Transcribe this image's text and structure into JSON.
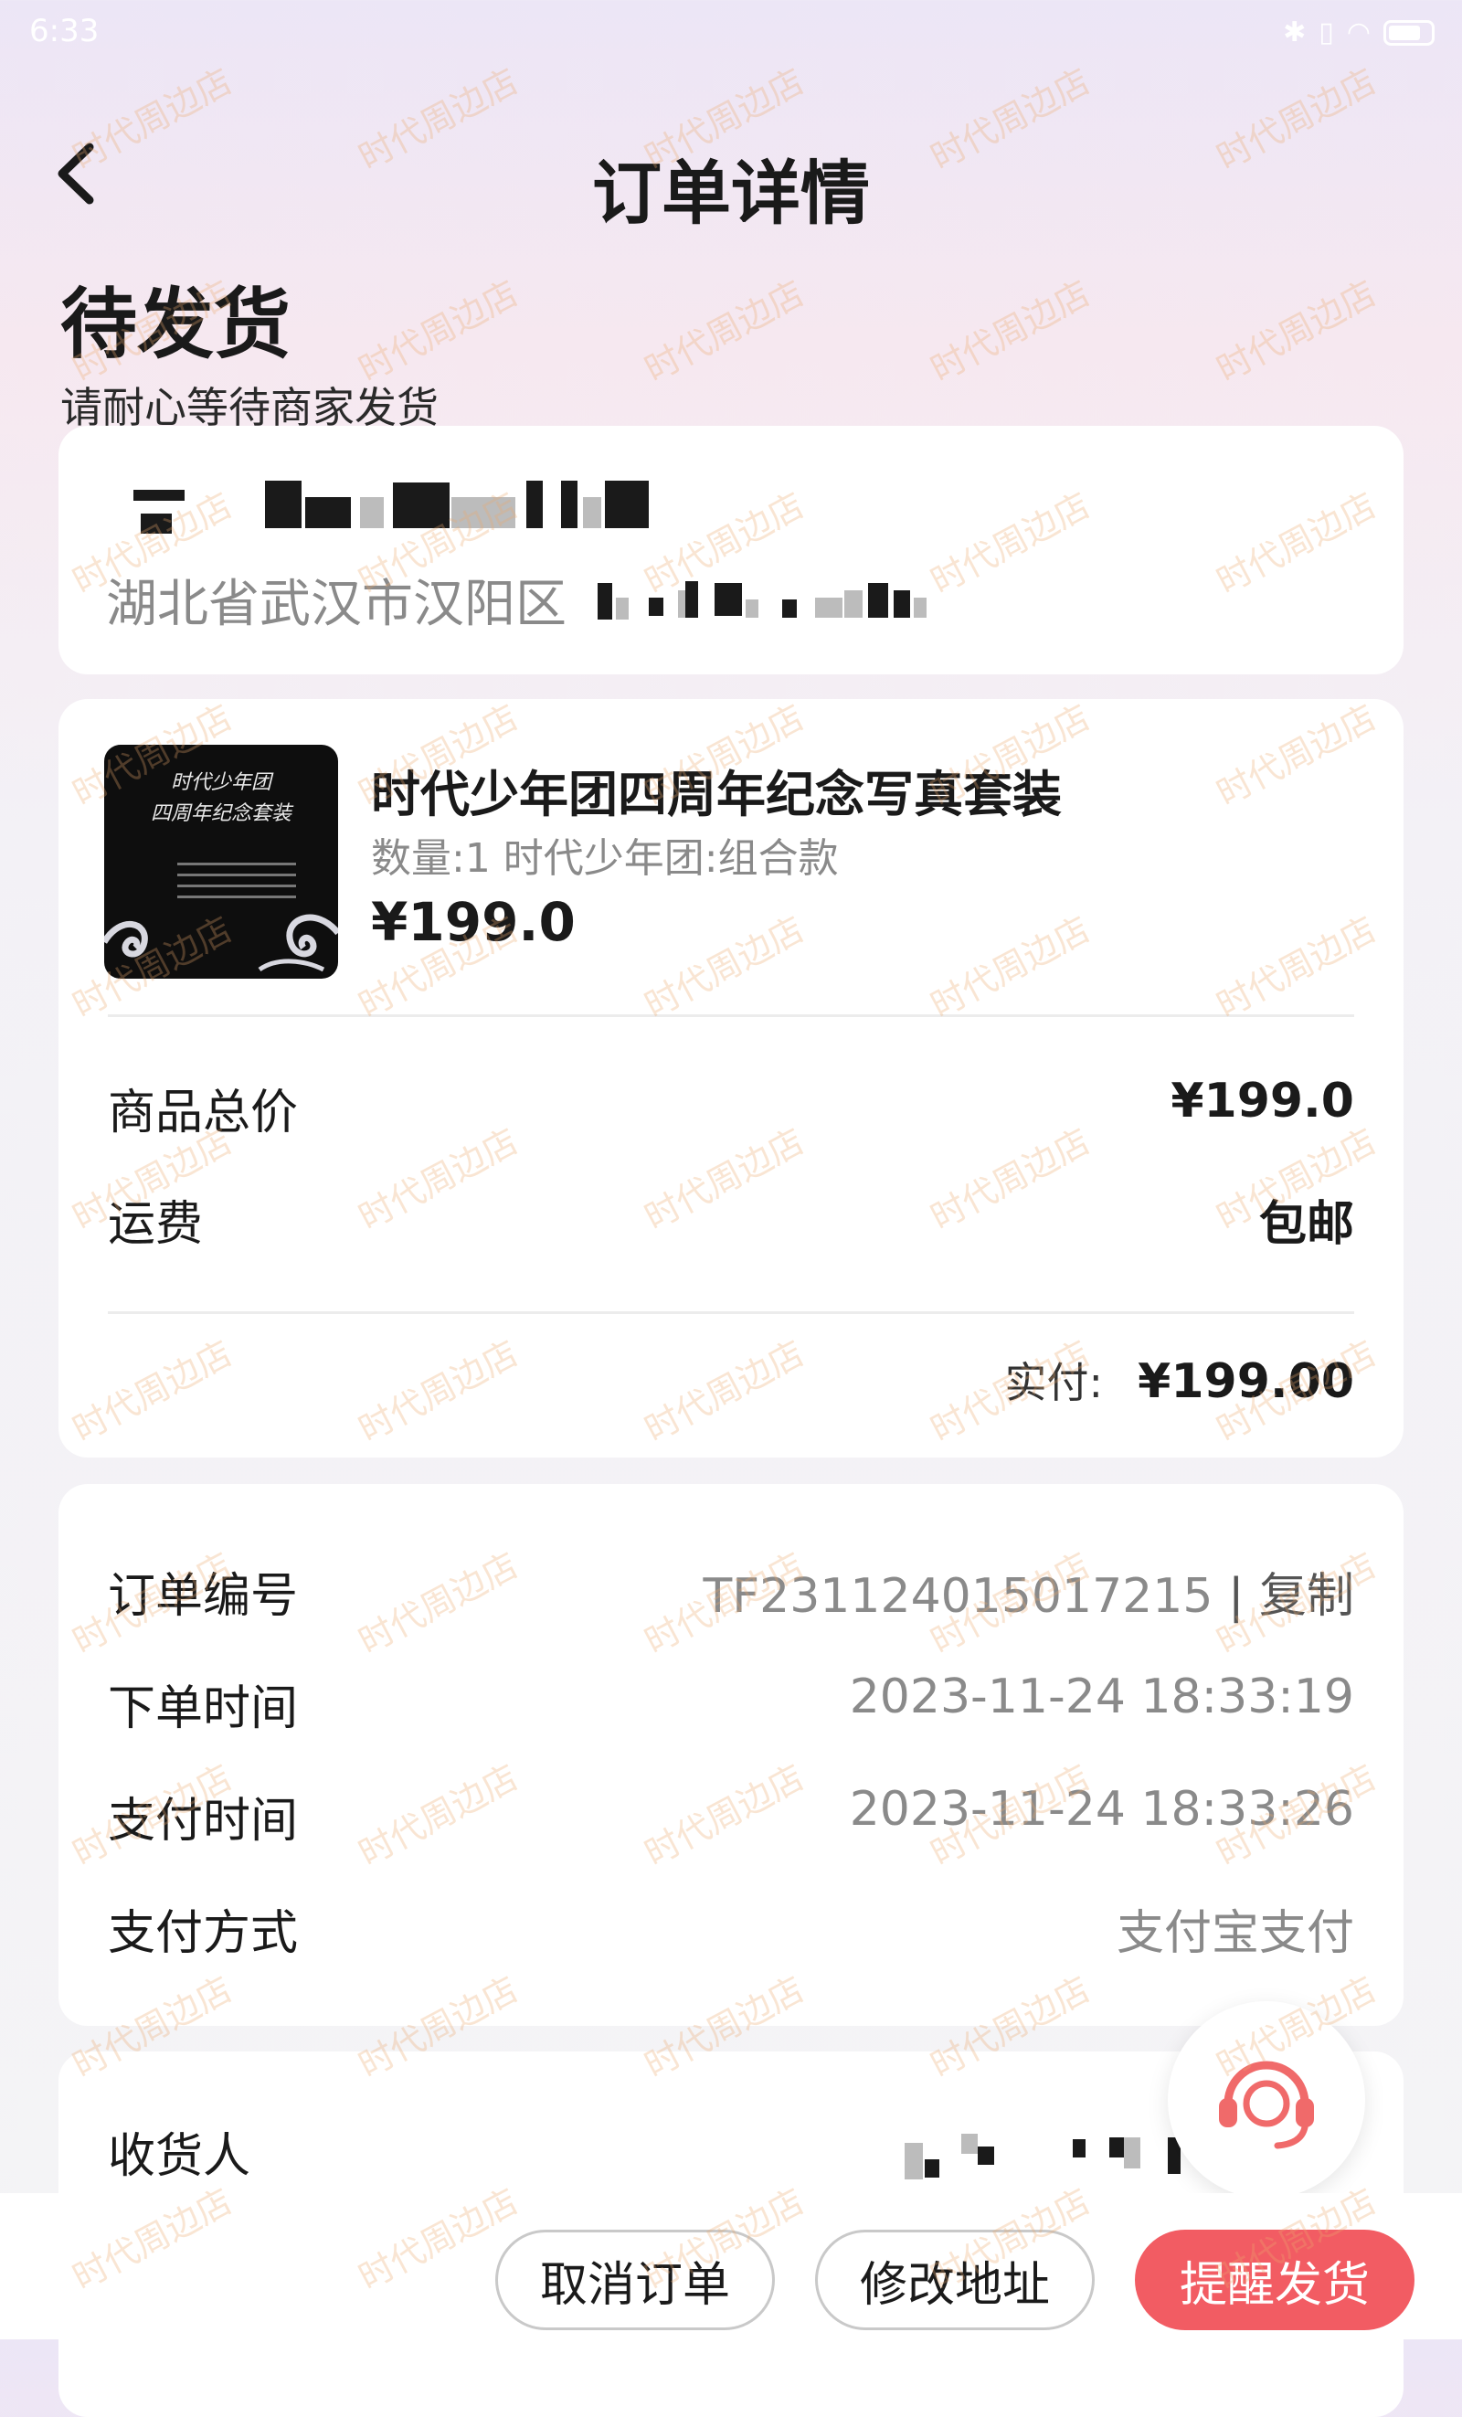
{
  "status_bar": {
    "time": "6:33"
  },
  "header": {
    "title": "订单详情"
  },
  "order_state": {
    "title": "待发货",
    "subtitle": "请耐心等待商家发货"
  },
  "address": {
    "line_visible": "湖北省武汉市汉阳区"
  },
  "product": {
    "image_title": "时代少年团\n四周年纪念套装",
    "name": "时代少年团四周年纪念写真套装",
    "spec": "数量:1 时代少年团:组合款",
    "price": "¥199.0"
  },
  "price_summary": {
    "goods_total_label": "商品总价",
    "goods_total_value": "¥199.0",
    "shipping_label": "运费",
    "shipping_value": "包邮",
    "paid_label": "实付:",
    "paid_value": "¥199.00"
  },
  "order_info": {
    "order_no_label": "订单编号",
    "order_no_value": "TF231124015017215",
    "copy_label": "| 复制",
    "order_time_label": "下单时间",
    "order_time_value": "2023-11-24 18:33:19",
    "pay_time_label": "支付时间",
    "pay_time_value": "2023-11-24 18:33:26",
    "pay_method_label": "支付方式",
    "pay_method_value": "支付宝支付"
  },
  "receiver": {
    "label": "收货人"
  },
  "actions": {
    "cancel": "取消订单",
    "modify_address": "修改地址",
    "remind": "提醒发货"
  },
  "watermark": "时代周边店",
  "colors": {
    "primary": "#f25c63",
    "muted_text": "#8a8a8a",
    "background": "#f4f4f6"
  }
}
